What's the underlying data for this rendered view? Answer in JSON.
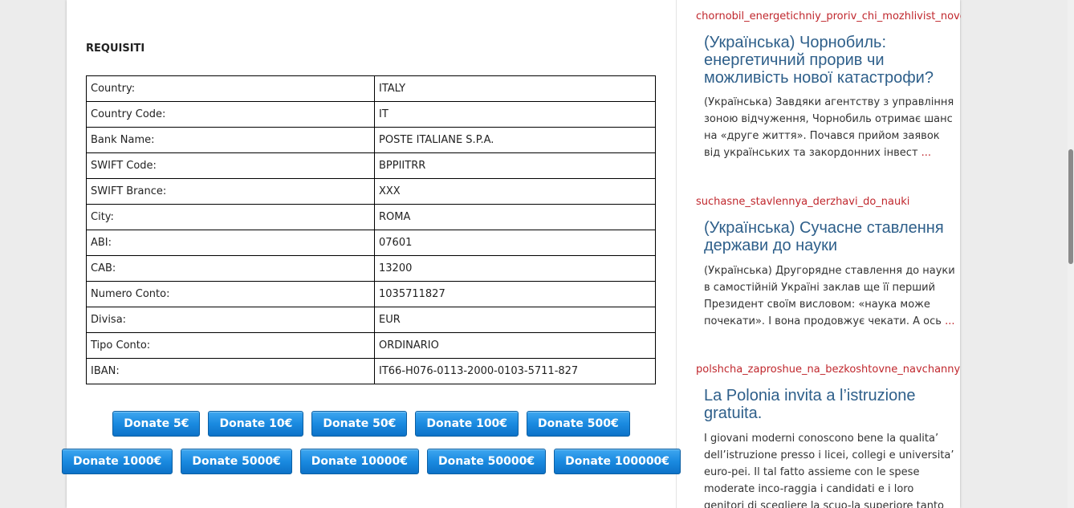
{
  "requisiti": {
    "title": "REQUISITI",
    "rows": [
      {
        "label": "Country:",
        "value": "ITALY"
      },
      {
        "label": "Country Code:",
        "value": "IT"
      },
      {
        "label": "Bank Name:",
        "value": "POSTE ITALIANE S.P.A."
      },
      {
        "label": "SWIFT Code:",
        "value": "BPPIITRR"
      },
      {
        "label": "SWIFT Brance:",
        "value": "XXX"
      },
      {
        "label": "City:",
        "value": "ROMA"
      },
      {
        "label": "ABI:",
        "value": "07601"
      },
      {
        "label": "CAB:",
        "value": "13200"
      },
      {
        "label": "Numero Conto:",
        "value": "1035711827"
      },
      {
        "label": "Divisa:",
        "value": "EUR"
      },
      {
        "label": "Tipo Conto:",
        "value": "ORDINARIO"
      },
      {
        "label": "IBAN:",
        "value": "IT66-H076-0113-2000-0103-5711-827"
      }
    ]
  },
  "donate": {
    "row1": [
      "Donate 5€",
      "Donate 10€",
      "Donate 50€",
      "Donate 100€",
      "Donate 500€"
    ],
    "row2": [
      "Donate 1000€",
      "Donate 5000€",
      "Donate 10000€",
      "Donate 50000€",
      "Donate 100000€"
    ]
  },
  "sidebar": {
    "posts": [
      {
        "slug": "chornobil_energetichniy_proriv_chi_mozhlivist_novoyi_katastrofi",
        "title": "(Українська) Чорнобиль: енергетичний прорив чи можливість нової катастрофи?",
        "excerpt": "(Українська) Завдяки агентству з управління зоною відчуження, Чорнобиль отримає шанс на «друге життя». Почався прийом заявок від українських та закордонних інвест",
        "more": "..."
      },
      {
        "slug": "suchasne_stavlennya_derzhavi_do_nauki",
        "title": "(Українська) Сучасне ставлення держави до науки",
        "excerpt": "(Українська) Другорядне ставлення до науки в самостійній Україні заклав ще її перший Президент своїм висловом: «наука може почекати». І вона продовжує чекати. А ось",
        "more": "..."
      },
      {
        "slug": "polshcha_zaproshue_na_bezkoshtovne_navchannya",
        "title": "La Polonia invita a l’istruzione gratuita.",
        "excerpt": "I giovani moderni conoscono bene la qualita’ dell’istruzione presso i licei, collegi e universita’ euro-pei. Il tal fatto assieme con le spese moderate inco-raggia i candidati e i loro genitori di scegliere la scuo-la superiore tanto prima del ballo di fine anno. Co-",
        "more": ""
      }
    ]
  }
}
